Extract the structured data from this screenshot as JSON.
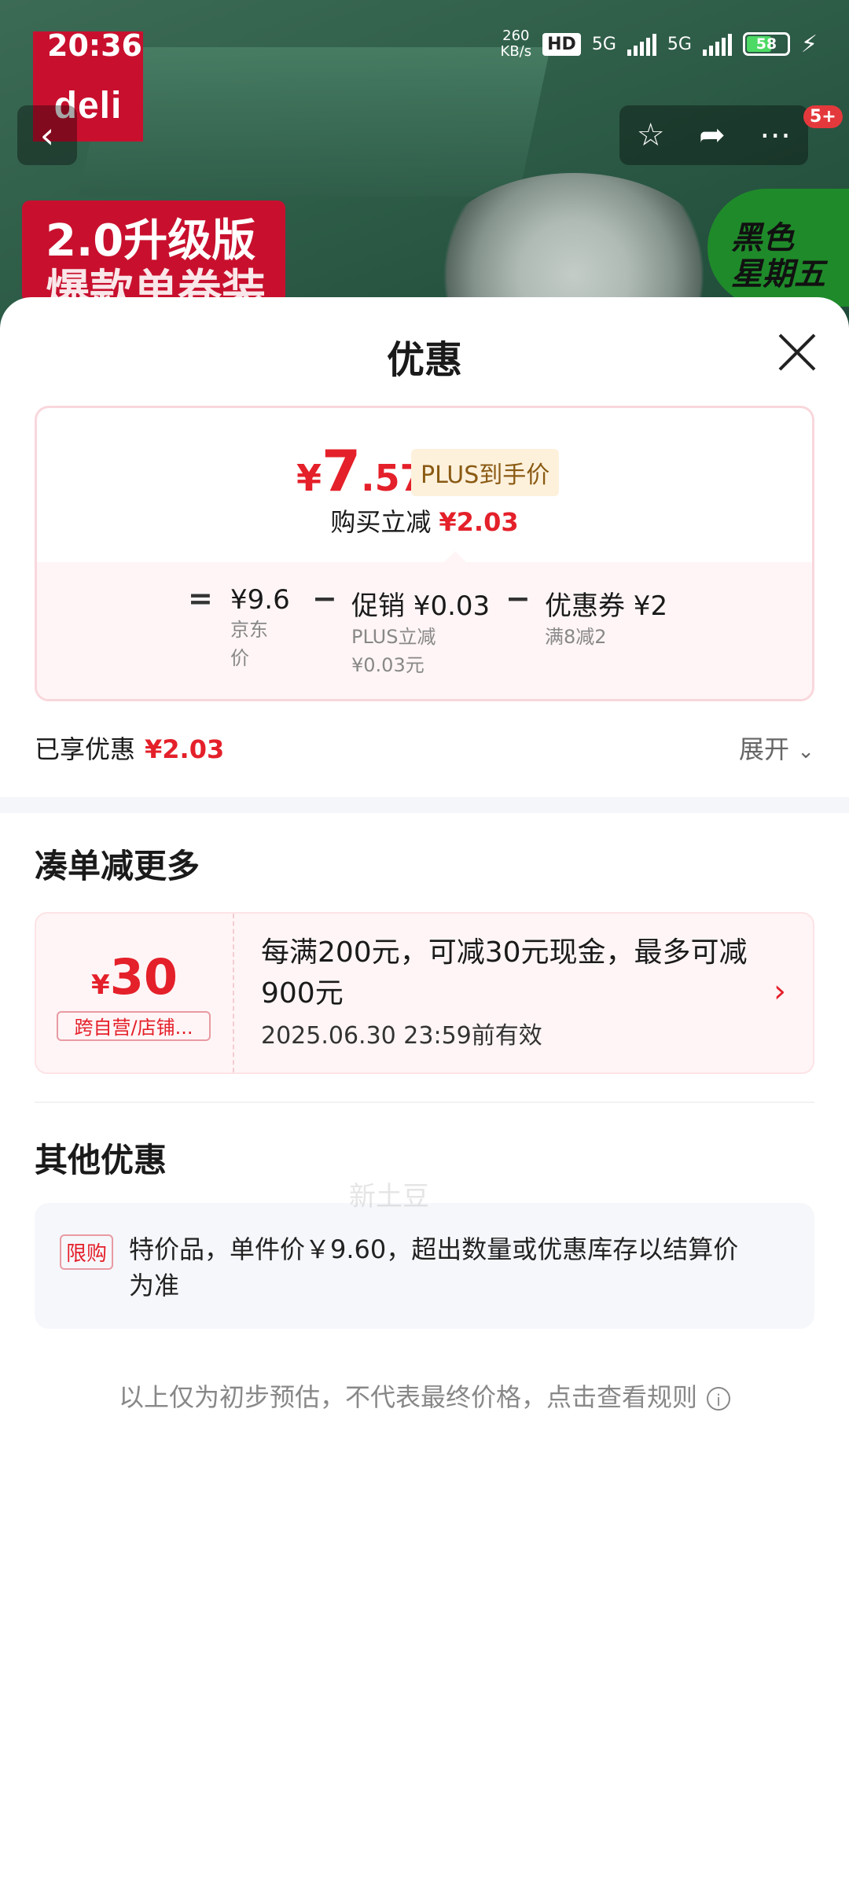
{
  "status_bar": {
    "time": "20:36",
    "net_speed": "260",
    "net_unit": "KB/s",
    "hd": "HD",
    "net1": "5G",
    "net2": "5G",
    "battery": "58"
  },
  "hero": {
    "brand_logo": "deli",
    "promo_line1": "2.0升级版",
    "promo_line2": "爆款单卷装",
    "event_line1": "黑色",
    "event_line2": "星期五",
    "more_badge": "5+"
  },
  "sheet": {
    "title": "优惠",
    "price": {
      "currency": "¥",
      "integer": "7",
      "decimal": ".57",
      "tag": "PLUS到手价",
      "reduce_label": "购买立减",
      "reduce_value": "¥2.03"
    },
    "formula": {
      "eq": "=",
      "jd_price": "¥9.6",
      "jd_label_1": "京东",
      "jd_label_2": "价",
      "minus1": "−",
      "promo_label": "促销 ¥0.03",
      "promo_sub1": "PLUS立减",
      "promo_sub2": "¥0.03元",
      "minus2": "−",
      "coupon_label": "优惠券 ¥2",
      "coupon_sub": "满8减2"
    },
    "enjoyed_label": "已享优惠",
    "enjoyed_value": "¥2.03",
    "expand_label": "展开",
    "more_section_title": "凑单减更多",
    "coupon": {
      "currency": "¥",
      "amount": "30",
      "scope": "跨自营/店铺...",
      "desc": "每满200元，可减30元现金，最多可减900元",
      "valid": "2025.06.30 23:59前有效"
    },
    "other_section_title": "其他优惠",
    "limit": {
      "tag": "限购",
      "text": "特价品，单件价￥9.60，超出数量或优惠库存以结算价为准"
    },
    "footnote": "以上仅为初步预估，不代表最终价格，点击查看规则",
    "watermark": "新土豆"
  }
}
